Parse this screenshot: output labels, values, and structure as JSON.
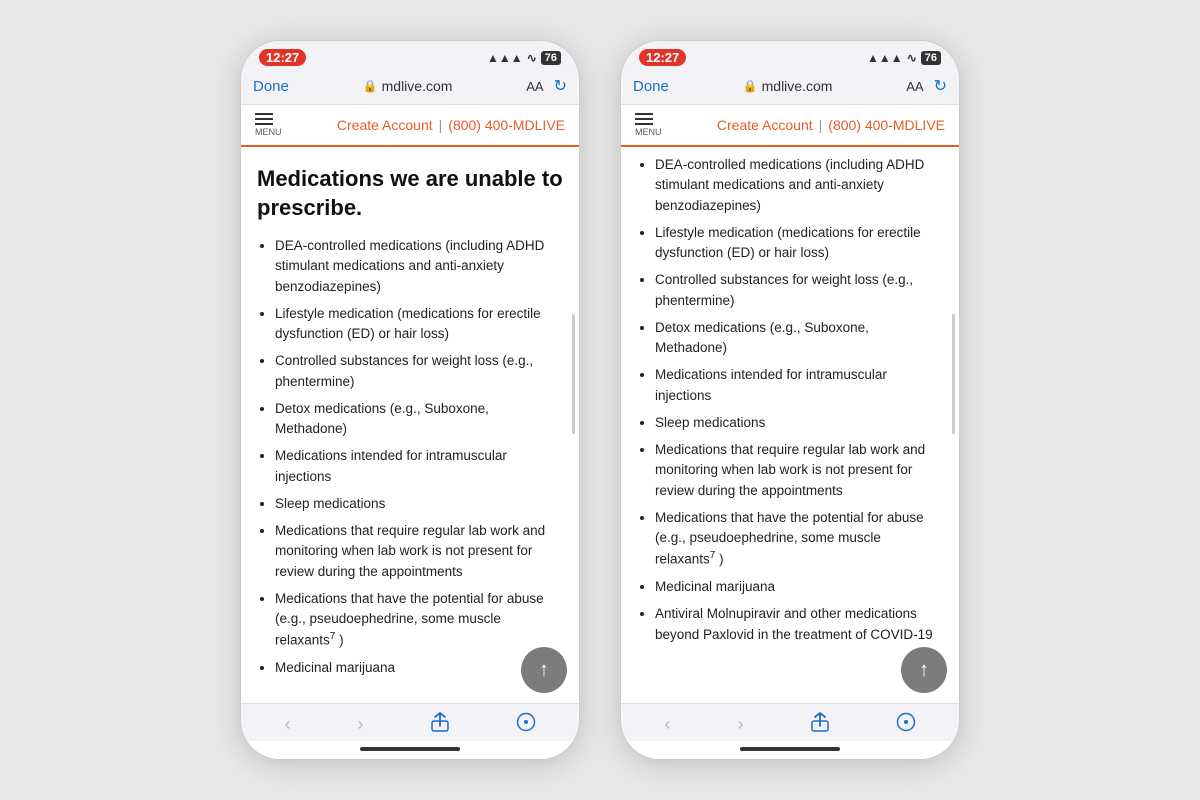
{
  "phones": [
    {
      "id": "phone-left",
      "statusBar": {
        "time": "12:27",
        "battery": "76"
      },
      "browserBar": {
        "done": "Done",
        "url": "mdlive.com",
        "aa": "AA"
      },
      "navBar": {
        "menu": "MENU",
        "createAccount": "Create Account",
        "divider": "|",
        "phone": "(800) 400-MDLIVE"
      },
      "content": {
        "title": "Medications we are unable to prescribe.",
        "items": [
          "DEA-controlled medications (including ADHD stimulant medications and anti-anxiety benzodiazepines)",
          "Lifestyle medication (medications for erectile dysfunction (ED) or hair loss)",
          "Controlled substances for weight loss (e.g., phentermine)",
          "Detox medications (e.g., Suboxone, Methadone)",
          "Medications intended for intramuscular injections",
          "Sleep medications",
          "Medications that require regular lab work and monitoring when lab work is not present for review during the appointments",
          "Medications that have the potential for abuse (e.g., pseudoephedrine, some muscle relaxants",
          ")",
          "Medicinal marijuana"
        ],
        "superscript": "7"
      }
    },
    {
      "id": "phone-right",
      "statusBar": {
        "time": "12:27",
        "battery": "76"
      },
      "browserBar": {
        "done": "Done",
        "url": "mdlive.com",
        "aa": "AA"
      },
      "navBar": {
        "menu": "MENU",
        "createAccount": "Create Account",
        "divider": "|",
        "phone": "(800) 400-MDLIVE"
      },
      "content": {
        "items": [
          "DEA-controlled medications (including ADHD stimulant medications and anti-anxiety benzodiazepines)",
          "Lifestyle medication (medications for erectile dysfunction (ED) or hair loss)",
          "Controlled substances for weight loss (e.g., phentermine)",
          "Detox medications (e.g., Suboxone, Methadone)",
          "Medications intended for intramuscular injections",
          "Sleep medications",
          "Medications that require regular lab work and monitoring when lab work is not present for review during the appointments",
          "Medications that have the potential for abuse (e.g., pseudoephedrine, some muscle relaxants",
          ")",
          "Medicinal marijuana",
          "Antiviral Molnupiravir and other medications beyond Paxlovid in the treatment of COVID-19"
        ],
        "superscript": "7"
      }
    }
  ],
  "scrollUpLabel": "↑",
  "bottomBar": {
    "back": "‹",
    "forward": "›",
    "share": "⬆",
    "compass": "◎"
  }
}
